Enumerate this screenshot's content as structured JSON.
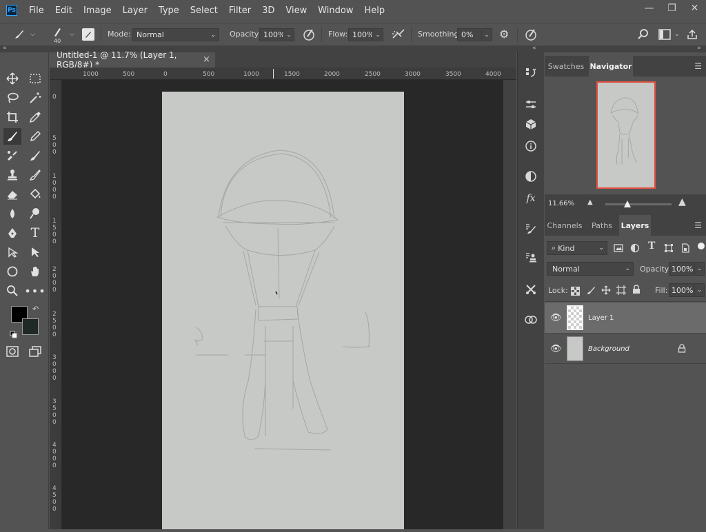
{
  "app": {
    "logo_text": "Ps"
  },
  "menu": [
    "File",
    "Edit",
    "Image",
    "Layer",
    "Type",
    "Select",
    "Filter",
    "3D",
    "View",
    "Window",
    "Help"
  ],
  "window_controls": {
    "minimize": "—",
    "restore": "❐",
    "close": "✕"
  },
  "options_bar": {
    "brush_size": "40",
    "mode_label": "Mode:",
    "mode_value": "Normal",
    "opacity_label": "Opacity:",
    "opacity_value": "100%",
    "flow_label": "Flow:",
    "flow_value": "100%",
    "smoothing_label": "Smoothing:",
    "smoothing_value": "0%"
  },
  "document": {
    "tab_title": "Untitled-1 @ 11.7% (Layer 1, RGB/8#) *",
    "close_glyph": "×"
  },
  "ruler": {
    "h_ticks": [
      "1000",
      "500",
      "0",
      "500",
      "1000",
      "1500",
      "2000",
      "2500",
      "3000",
      "3500",
      "4000"
    ],
    "v_ticks": [
      "0",
      "5\n0\n0",
      "1\n0\n0\n0",
      "1\n5\n0\n0",
      "2\n0\n0\n0",
      "2\n5\n0\n0",
      "3\n0\n0\n0",
      "3\n5\n0\n0",
      "4\n0\n0\n0",
      "4\n5\n0\n0"
    ]
  },
  "panels": {
    "top_tabs": [
      "Swatches",
      "Navigator"
    ],
    "top_active": "Navigator",
    "zoom_value": "11.66%",
    "bottom_tabs": [
      "Channels",
      "Paths",
      "Layers"
    ],
    "bottom_active": "Layers",
    "filter_kind": "Kind",
    "blend_mode": "Normal",
    "opacity_label": "Opacity:",
    "opacity_value": "100%",
    "lock_label": "Lock:",
    "fill_label": "Fill:",
    "fill_value": "100%",
    "layers": [
      {
        "name": "Layer 1",
        "selected": true
      },
      {
        "name": "Background",
        "selected": false,
        "locked": true
      }
    ]
  },
  "colors": {
    "foreground": "#000000",
    "background": "#1f2a27",
    "accent_red": "#e25041"
  }
}
